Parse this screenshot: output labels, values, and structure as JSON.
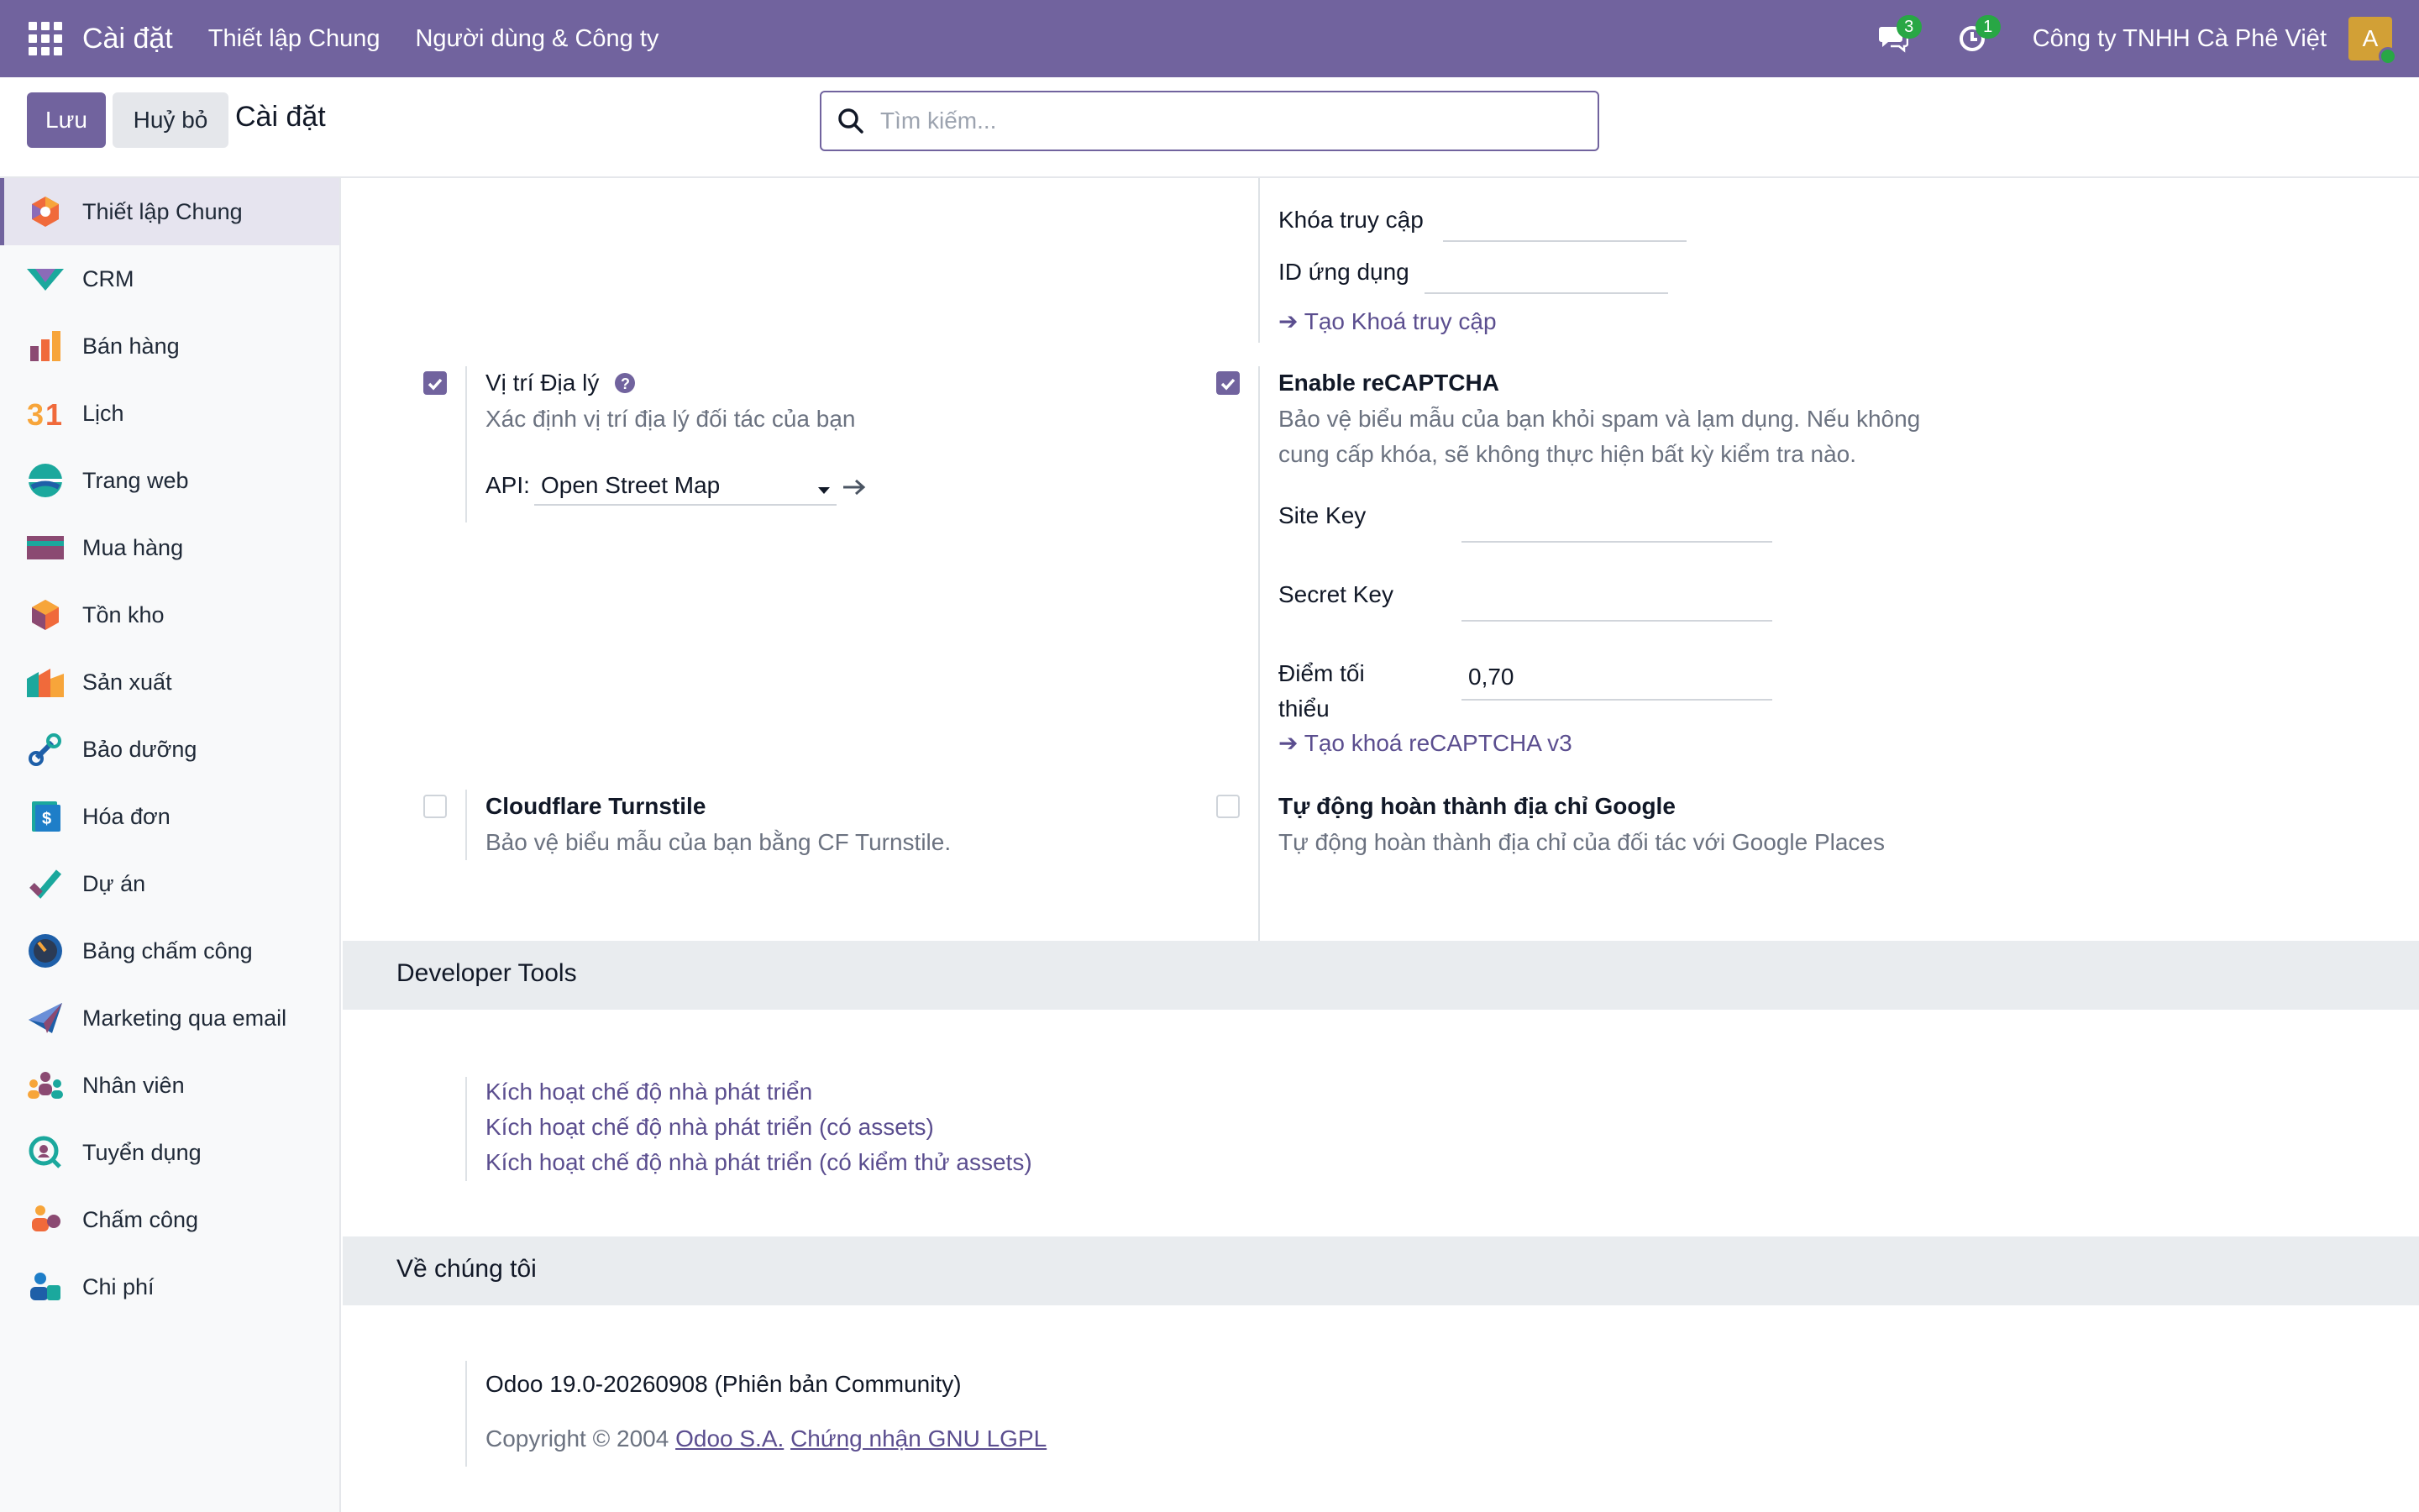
{
  "navbar": {
    "brand": "Cài đặt",
    "menus": [
      "Thiết lập Chung",
      "Người dùng & Công ty"
    ],
    "messages_badge": "3",
    "activities_badge": "1",
    "company": "Công ty TNHH Cà Phê Việt",
    "avatar_letter": "A",
    "bg_color": "#71639e"
  },
  "control_panel": {
    "save_label": "Lưu",
    "cancel_label": "Huỷ bỏ",
    "title": "Cài đặt",
    "search_placeholder": "Tìm kiếm..."
  },
  "sidebar": {
    "items": [
      {
        "label": "Thiết lập Chung",
        "icon": "general-settings-icon",
        "active": true
      },
      {
        "label": "CRM",
        "icon": "crm-icon"
      },
      {
        "label": "Bán hàng",
        "icon": "sales-icon"
      },
      {
        "label": "Lịch",
        "icon": "calendar-icon"
      },
      {
        "label": "Trang web",
        "icon": "website-icon"
      },
      {
        "label": "Mua hàng",
        "icon": "purchase-icon"
      },
      {
        "label": "Tồn kho",
        "icon": "inventory-icon"
      },
      {
        "label": "Sản xuất",
        "icon": "manufacturing-icon"
      },
      {
        "label": "Bảo dưỡng",
        "icon": "maintenance-icon"
      },
      {
        "label": "Hóa đơn",
        "icon": "invoicing-icon"
      },
      {
        "label": "Dự án",
        "icon": "project-icon"
      },
      {
        "label": "Bảng chấm công",
        "icon": "timesheet-icon"
      },
      {
        "label": "Marketing qua email",
        "icon": "email-marketing-icon"
      },
      {
        "label": "Nhân viên",
        "icon": "employees-icon"
      },
      {
        "label": "Tuyển dụng",
        "icon": "recruitment-icon"
      },
      {
        "label": "Chấm công",
        "icon": "attendance-icon"
      },
      {
        "label": "Chi phí",
        "icon": "expenses-icon"
      }
    ]
  },
  "content": {
    "access_key_label": "Khóa truy cập",
    "app_id_label": "ID ứng dụng",
    "create_access_key_link": "Tạo Khoá truy cập",
    "geo": {
      "title": "Vị trí Địa lý",
      "description": "Xác định vị trí địa lý đối tác của bạn",
      "api_label": "API:",
      "api_value": "Open Street Map",
      "checked": true
    },
    "recaptcha": {
      "title": "Enable reCAPTCHA",
      "description_line1": "Bảo vệ biểu mẫu của bạn khỏi spam và lạm dụng. Nếu không",
      "description_line2": "cung cấp khóa, sẽ không thực hiện bất kỳ kiểm tra nào.",
      "site_key_label": "Site Key",
      "secret_key_label": "Secret Key",
      "min_score_label_1": "Điểm tối",
      "min_score_label_2": "thiểu",
      "min_score_value": "0,70",
      "create_key_link": "Tạo khoá reCAPTCHA v3",
      "checked": true
    },
    "turnstile": {
      "title": "Cloudflare Turnstile",
      "description": "Bảo vệ biểu mẫu của bạn bằng CF Turnstile.",
      "checked": false
    },
    "google_autocomplete": {
      "title": "Tự động hoàn thành địa chỉ Google",
      "description": "Tự động hoàn thành địa chỉ của đối tác với Google Places",
      "checked": false
    },
    "developer_tools": {
      "section_title": "Developer Tools",
      "links": [
        "Kích hoạt chế độ nhà phát triển",
        "Kích hoạt chế độ nhà phát triển (có assets)",
        "Kích hoạt chế độ nhà phát triển (có kiểm thử assets)"
      ]
    },
    "about": {
      "section_title": "Về chúng tôi",
      "version": "Odoo 19.0-20260908 (Phiên bản Community)",
      "copyright": "Copyright © 2004",
      "company_link": "Odoo S.A.",
      "license_link": "Chứng nhận GNU LGPL"
    }
  }
}
